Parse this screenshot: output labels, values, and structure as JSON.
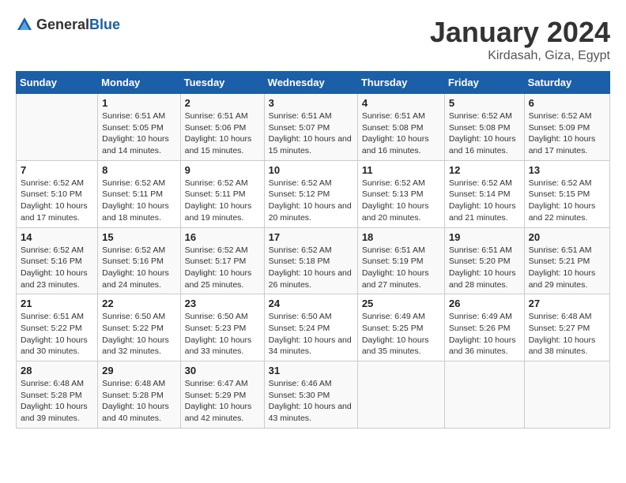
{
  "logo": {
    "text_general": "General",
    "text_blue": "Blue"
  },
  "title": "January 2024",
  "subtitle": "Kirdasah, Giza, Egypt",
  "header_days": [
    "Sunday",
    "Monday",
    "Tuesday",
    "Wednesday",
    "Thursday",
    "Friday",
    "Saturday"
  ],
  "weeks": [
    [
      {
        "day": "",
        "sunrise": "",
        "sunset": "",
        "daylight": ""
      },
      {
        "day": "1",
        "sunrise": "Sunrise: 6:51 AM",
        "sunset": "Sunset: 5:05 PM",
        "daylight": "Daylight: 10 hours and 14 minutes."
      },
      {
        "day": "2",
        "sunrise": "Sunrise: 6:51 AM",
        "sunset": "Sunset: 5:06 PM",
        "daylight": "Daylight: 10 hours and 15 minutes."
      },
      {
        "day": "3",
        "sunrise": "Sunrise: 6:51 AM",
        "sunset": "Sunset: 5:07 PM",
        "daylight": "Daylight: 10 hours and 15 minutes."
      },
      {
        "day": "4",
        "sunrise": "Sunrise: 6:51 AM",
        "sunset": "Sunset: 5:08 PM",
        "daylight": "Daylight: 10 hours and 16 minutes."
      },
      {
        "day": "5",
        "sunrise": "Sunrise: 6:52 AM",
        "sunset": "Sunset: 5:08 PM",
        "daylight": "Daylight: 10 hours and 16 minutes."
      },
      {
        "day": "6",
        "sunrise": "Sunrise: 6:52 AM",
        "sunset": "Sunset: 5:09 PM",
        "daylight": "Daylight: 10 hours and 17 minutes."
      }
    ],
    [
      {
        "day": "7",
        "sunrise": "Sunrise: 6:52 AM",
        "sunset": "Sunset: 5:10 PM",
        "daylight": "Daylight: 10 hours and 17 minutes."
      },
      {
        "day": "8",
        "sunrise": "Sunrise: 6:52 AM",
        "sunset": "Sunset: 5:11 PM",
        "daylight": "Daylight: 10 hours and 18 minutes."
      },
      {
        "day": "9",
        "sunrise": "Sunrise: 6:52 AM",
        "sunset": "Sunset: 5:11 PM",
        "daylight": "Daylight: 10 hours and 19 minutes."
      },
      {
        "day": "10",
        "sunrise": "Sunrise: 6:52 AM",
        "sunset": "Sunset: 5:12 PM",
        "daylight": "Daylight: 10 hours and 20 minutes."
      },
      {
        "day": "11",
        "sunrise": "Sunrise: 6:52 AM",
        "sunset": "Sunset: 5:13 PM",
        "daylight": "Daylight: 10 hours and 20 minutes."
      },
      {
        "day": "12",
        "sunrise": "Sunrise: 6:52 AM",
        "sunset": "Sunset: 5:14 PM",
        "daylight": "Daylight: 10 hours and 21 minutes."
      },
      {
        "day": "13",
        "sunrise": "Sunrise: 6:52 AM",
        "sunset": "Sunset: 5:15 PM",
        "daylight": "Daylight: 10 hours and 22 minutes."
      }
    ],
    [
      {
        "day": "14",
        "sunrise": "Sunrise: 6:52 AM",
        "sunset": "Sunset: 5:16 PM",
        "daylight": "Daylight: 10 hours and 23 minutes."
      },
      {
        "day": "15",
        "sunrise": "Sunrise: 6:52 AM",
        "sunset": "Sunset: 5:16 PM",
        "daylight": "Daylight: 10 hours and 24 minutes."
      },
      {
        "day": "16",
        "sunrise": "Sunrise: 6:52 AM",
        "sunset": "Sunset: 5:17 PM",
        "daylight": "Daylight: 10 hours and 25 minutes."
      },
      {
        "day": "17",
        "sunrise": "Sunrise: 6:52 AM",
        "sunset": "Sunset: 5:18 PM",
        "daylight": "Daylight: 10 hours and 26 minutes."
      },
      {
        "day": "18",
        "sunrise": "Sunrise: 6:51 AM",
        "sunset": "Sunset: 5:19 PM",
        "daylight": "Daylight: 10 hours and 27 minutes."
      },
      {
        "day": "19",
        "sunrise": "Sunrise: 6:51 AM",
        "sunset": "Sunset: 5:20 PM",
        "daylight": "Daylight: 10 hours and 28 minutes."
      },
      {
        "day": "20",
        "sunrise": "Sunrise: 6:51 AM",
        "sunset": "Sunset: 5:21 PM",
        "daylight": "Daylight: 10 hours and 29 minutes."
      }
    ],
    [
      {
        "day": "21",
        "sunrise": "Sunrise: 6:51 AM",
        "sunset": "Sunset: 5:22 PM",
        "daylight": "Daylight: 10 hours and 30 minutes."
      },
      {
        "day": "22",
        "sunrise": "Sunrise: 6:50 AM",
        "sunset": "Sunset: 5:22 PM",
        "daylight": "Daylight: 10 hours and 32 minutes."
      },
      {
        "day": "23",
        "sunrise": "Sunrise: 6:50 AM",
        "sunset": "Sunset: 5:23 PM",
        "daylight": "Daylight: 10 hours and 33 minutes."
      },
      {
        "day": "24",
        "sunrise": "Sunrise: 6:50 AM",
        "sunset": "Sunset: 5:24 PM",
        "daylight": "Daylight: 10 hours and 34 minutes."
      },
      {
        "day": "25",
        "sunrise": "Sunrise: 6:49 AM",
        "sunset": "Sunset: 5:25 PM",
        "daylight": "Daylight: 10 hours and 35 minutes."
      },
      {
        "day": "26",
        "sunrise": "Sunrise: 6:49 AM",
        "sunset": "Sunset: 5:26 PM",
        "daylight": "Daylight: 10 hours and 36 minutes."
      },
      {
        "day": "27",
        "sunrise": "Sunrise: 6:48 AM",
        "sunset": "Sunset: 5:27 PM",
        "daylight": "Daylight: 10 hours and 38 minutes."
      }
    ],
    [
      {
        "day": "28",
        "sunrise": "Sunrise: 6:48 AM",
        "sunset": "Sunset: 5:28 PM",
        "daylight": "Daylight: 10 hours and 39 minutes."
      },
      {
        "day": "29",
        "sunrise": "Sunrise: 6:48 AM",
        "sunset": "Sunset: 5:28 PM",
        "daylight": "Daylight: 10 hours and 40 minutes."
      },
      {
        "day": "30",
        "sunrise": "Sunrise: 6:47 AM",
        "sunset": "Sunset: 5:29 PM",
        "daylight": "Daylight: 10 hours and 42 minutes."
      },
      {
        "day": "31",
        "sunrise": "Sunrise: 6:46 AM",
        "sunset": "Sunset: 5:30 PM",
        "daylight": "Daylight: 10 hours and 43 minutes."
      },
      {
        "day": "",
        "sunrise": "",
        "sunset": "",
        "daylight": ""
      },
      {
        "day": "",
        "sunrise": "",
        "sunset": "",
        "daylight": ""
      },
      {
        "day": "",
        "sunrise": "",
        "sunset": "",
        "daylight": ""
      }
    ]
  ]
}
